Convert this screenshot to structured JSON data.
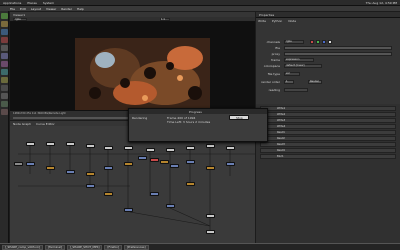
{
  "system": {
    "apps_label": "Applications",
    "places_label": "Places",
    "system_label": "System",
    "window_title": "_SHARE_comp_v003.nk",
    "clock": "Thu Aug 12, 4:59 PM"
  },
  "menu": [
    "File",
    "Edit",
    "Layout",
    "Viewer",
    "Render",
    "Help"
  ],
  "viewer": {
    "tab": "Viewer1",
    "channels": "rgba",
    "zoom": "1:1",
    "status_text": "1280x720 25x  1x1 3400 BG/Remote Light"
  },
  "dag": {
    "tabs": [
      "Node Graph",
      "Curve Editor"
    ]
  },
  "properties": {
    "title": "Properties",
    "tabs": [
      "Write",
      "Python",
      "Node"
    ],
    "fields": [
      {
        "label": "channels",
        "value": "rgba"
      },
      {
        "label": "file",
        "value": ""
      },
      {
        "label": "proxy",
        "value": ""
      },
      {
        "label": "frame",
        "value": "expression"
      },
      {
        "label": "colorspace",
        "value": "default (linear)"
      },
      {
        "label": "premultiplied",
        "value": ""
      },
      {
        "label": "raw data",
        "value": ""
      },
      {
        "label": "views",
        "value": ""
      },
      {
        "label": "file type",
        "value": "exr"
      },
      {
        "label": "proxy",
        "value": ""
      },
      {
        "label": "render order",
        "value": "1"
      },
      {
        "label": "Render",
        "value": ""
      },
      {
        "label": "reading",
        "value": ""
      }
    ],
    "collapsed": [
      "Write1",
      "Write2",
      "Write3",
      "Write4",
      "Read1",
      "Read2",
      "Read3",
      "Read4",
      "Blur1"
    ]
  },
  "dialog": {
    "title": "Progress",
    "line1": "Rendering",
    "line2": "Frame 400 of 1994",
    "line3": "Time Left: 3 hours 2 minutes",
    "button": "Stop"
  },
  "taskbar": [
    "[_SHARE_comp_v003.nk]",
    "[Terminal]",
    "[_SHARE_SHOT_MPS]",
    "[Firefox]",
    "[Preferences]"
  ],
  "colors": {
    "accent": "#e08a24",
    "dialog_button": "#d8d8d8",
    "node_read": "#c8c8c8",
    "node_merge": "#6a7fb3",
    "node_grade": "#b5852e"
  }
}
